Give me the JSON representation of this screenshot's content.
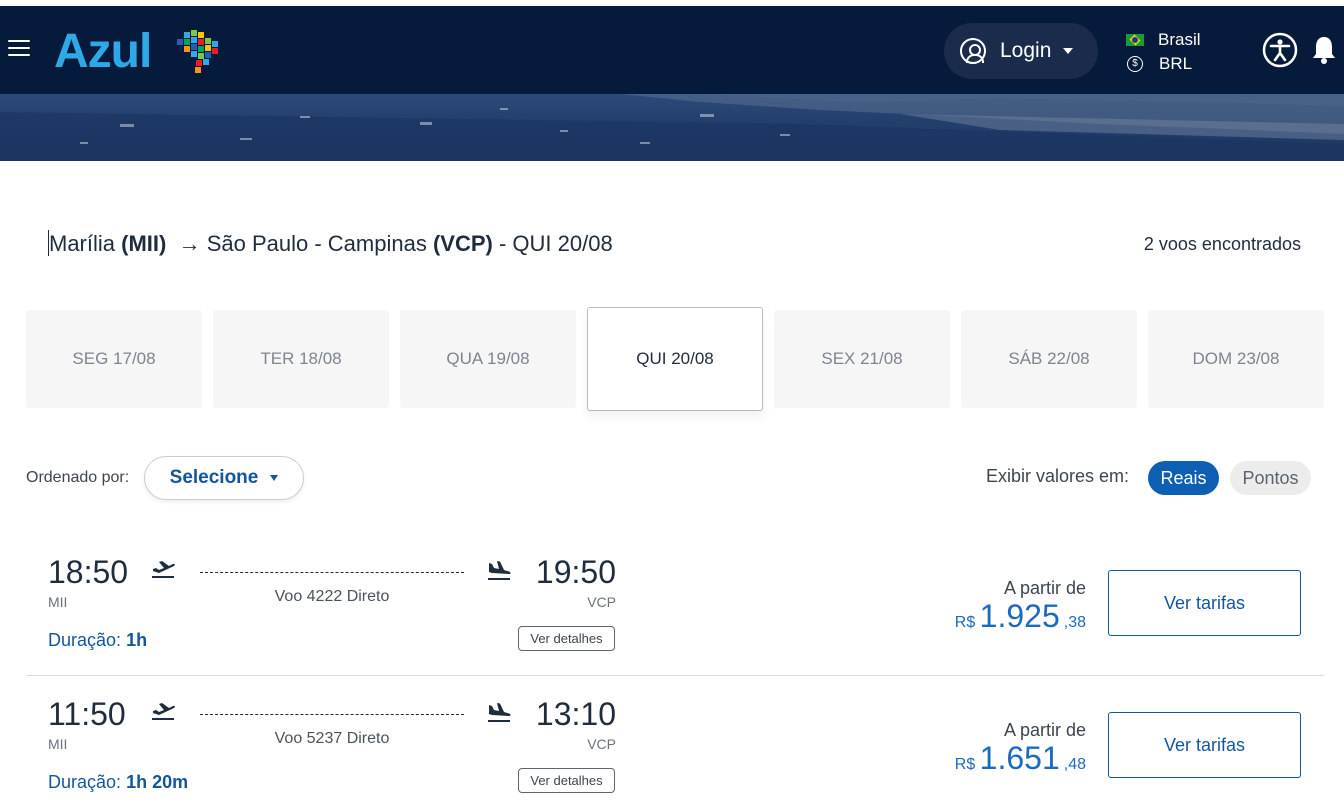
{
  "header": {
    "logo_text": "Azul",
    "login_label": "Login",
    "country": "Brasil",
    "currency": "BRL",
    "currency_symbol": "$",
    "brand_color": "#061a3c",
    "logo_color": "#2fa8e8"
  },
  "route": {
    "origin_city": "Marília",
    "origin_code": "(MII)",
    "arrow": "→",
    "dest_city": "São Paulo - Campinas",
    "dest_code": "(VCP)",
    "date_sep": "-",
    "date": "QUI 20/08",
    "found": "2 voos encontrados"
  },
  "dates": [
    {
      "label": "SEG 17/08",
      "active": false
    },
    {
      "label": "TER 18/08",
      "active": false
    },
    {
      "label": "QUA 19/08",
      "active": false
    },
    {
      "label": "QUI 20/08",
      "active": true
    },
    {
      "label": "SEX 21/08",
      "active": false
    },
    {
      "label": "SÁB 22/08",
      "active": false
    },
    {
      "label": "DOM 23/08",
      "active": false
    }
  ],
  "sort": {
    "label": "Ordenado por:",
    "selected": "Selecione"
  },
  "values": {
    "label": "Exibir valores em:",
    "options": [
      "Reais",
      "Pontos"
    ],
    "selected": "Reais",
    "accent": "#0d5fb3"
  },
  "flights": [
    {
      "dep_time": "18:50",
      "dep_code": "MII",
      "arr_time": "19:50",
      "arr_code": "VCP",
      "flight": "Voo 4222 Direto",
      "duration_label": "Duração:",
      "duration": "1h",
      "details_label": "Ver detalhes",
      "from_label": "A partir de",
      "currency": "R$",
      "price_main": "1.925",
      "price_cents": ",38",
      "fares_label": "Ver tarifas"
    },
    {
      "dep_time": "11:50",
      "dep_code": "MII",
      "arr_time": "13:10",
      "arr_code": "VCP",
      "flight": "Voo 5237 Direto",
      "duration_label": "Duração:",
      "duration": "1h 20m",
      "details_label": "Ver detalhes",
      "from_label": "A partir de",
      "currency": "R$",
      "price_main": "1.651",
      "price_cents": ",48",
      "fares_label": "Ver tarifas"
    }
  ]
}
